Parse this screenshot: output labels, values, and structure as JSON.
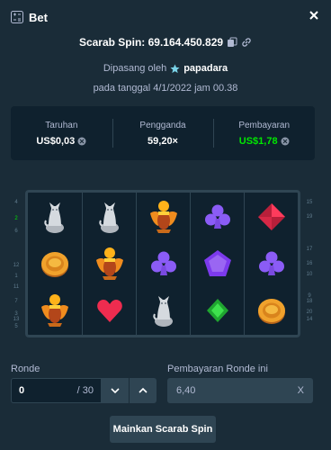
{
  "modal": {
    "title": "Bet",
    "close_icon": "close-icon"
  },
  "game": {
    "title": "Scarab Spin: 69.164.450.829"
  },
  "placed": {
    "prefix": "Dipasang oleh",
    "user": "papadara",
    "date": "pada tanggal 4/1/2022 jam 00.38"
  },
  "stats": [
    {
      "label": "Taruhan",
      "value": "US$0,03",
      "color": "#ffffff"
    },
    {
      "label": "Pengganda",
      "value": "59,20×",
      "color": "#ffffff"
    },
    {
      "label": "Pembayaran",
      "value": "US$1,78",
      "color": "#00e701"
    }
  ],
  "board": {
    "reels": [
      [
        "cat-statue",
        "gold-coin",
        "scarab"
      ],
      [
        "cat-statue",
        "scarab",
        "heart"
      ],
      [
        "scarab",
        "purple-club",
        "cat-statue"
      ],
      [
        "purple-club",
        "purple-pentagon",
        "green-diamond"
      ],
      [
        "red-diamond",
        "purple-club",
        "gold-coin"
      ]
    ],
    "left_numbers": [
      "4",
      "2",
      "6",
      "12",
      "1",
      "11",
      "7",
      "3",
      "13",
      "5"
    ],
    "right_numbers": [
      "15",
      "19",
      "17",
      "16",
      "10",
      "9",
      "18",
      "20",
      "14"
    ],
    "highlight": "2"
  },
  "ronde": {
    "label": "Ronde",
    "value": "0",
    "total": "/ 30"
  },
  "round_payout": {
    "label": "Pembayaran Ronde ini",
    "value": "6,40",
    "clear": "X"
  },
  "play_button": {
    "label": "Mainkan Scarab Spin"
  },
  "colors": {
    "background": "#1a2c38",
    "panel": "#0f212e",
    "border": "#2f4553",
    "green": "#00e701",
    "muted": "#b1bad3"
  }
}
